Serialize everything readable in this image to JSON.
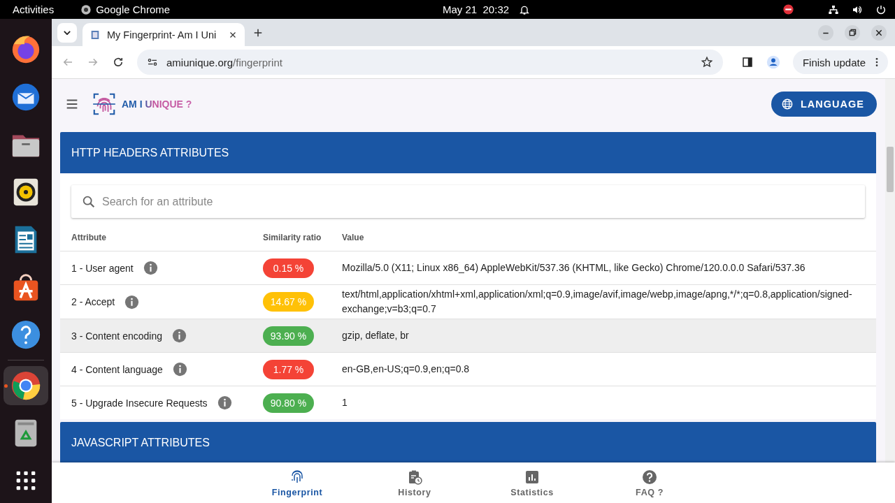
{
  "system_bar": {
    "activities": "Activities",
    "app": "Google Chrome",
    "date": "May 21",
    "time": "20:32"
  },
  "dock": [
    {
      "kind": "firefox",
      "running": false
    },
    {
      "kind": "mail",
      "running": false
    },
    {
      "kind": "files",
      "running": false
    },
    {
      "kind": "music",
      "running": false
    },
    {
      "kind": "writer",
      "running": false
    },
    {
      "kind": "store",
      "running": false
    },
    {
      "kind": "help",
      "running": false
    },
    {
      "kind": "chrome",
      "running": true
    },
    {
      "kind": "trash",
      "running": false
    },
    {
      "kind": "apps",
      "running": false
    }
  ],
  "browser": {
    "tab_title": "My Fingerprint- Am I Uni",
    "url_host": "amiunique.org",
    "url_path": "/fingerprint",
    "update_button": "Finish update"
  },
  "site": {
    "logo": "AM I UNIQUE ?",
    "language_button": "LANGUAGE"
  },
  "sections": [
    {
      "title": "HTTP HEADERS ATTRIBUTES",
      "search_placeholder": "Search for an attribute",
      "columns": [
        "Attribute",
        "Similarity ratio",
        "Value"
      ],
      "rows": [
        {
          "attribute": "1 - User agent",
          "ratio": "0.15 %",
          "color": "#f44336",
          "value": "Mozilla/5.0 (X11; Linux x86_64) AppleWebKit/537.36 (KHTML, like Gecko) Chrome/120.0.0.0 Safari/537.36",
          "highlighted": false
        },
        {
          "attribute": "2 - Accept",
          "ratio": "14.67 %",
          "color": "#ffc107",
          "value": "text/html,application/xhtml+xml,application/xml;q=0.9,image/avif,image/webp,image/apng,*/*;q=0.8,application/signed-exchange;v=b3;q=0.7",
          "highlighted": false
        },
        {
          "attribute": "3 - Content encoding",
          "ratio": "93.90 %",
          "color": "#4caf50",
          "value": "gzip, deflate, br",
          "highlighted": true
        },
        {
          "attribute": "4 - Content language",
          "ratio": "1.77 %",
          "color": "#f44336",
          "value": "en-GB,en-US;q=0.9,en;q=0.8",
          "highlighted": false
        },
        {
          "attribute": "5 - Upgrade Insecure Requests",
          "ratio": "90.80 %",
          "color": "#4caf50",
          "value": "1",
          "highlighted": false
        }
      ]
    },
    {
      "title": "JAVASCRIPT ATTRIBUTES"
    }
  ],
  "bottom_nav": [
    {
      "kind": "fingerprint",
      "label": "Fingerprint",
      "selected": true
    },
    {
      "kind": "history",
      "label": "History",
      "selected": false
    },
    {
      "kind": "statistics",
      "label": "Statistics",
      "selected": false
    },
    {
      "kind": "faq",
      "label": "FAQ ?",
      "selected": false
    }
  ]
}
